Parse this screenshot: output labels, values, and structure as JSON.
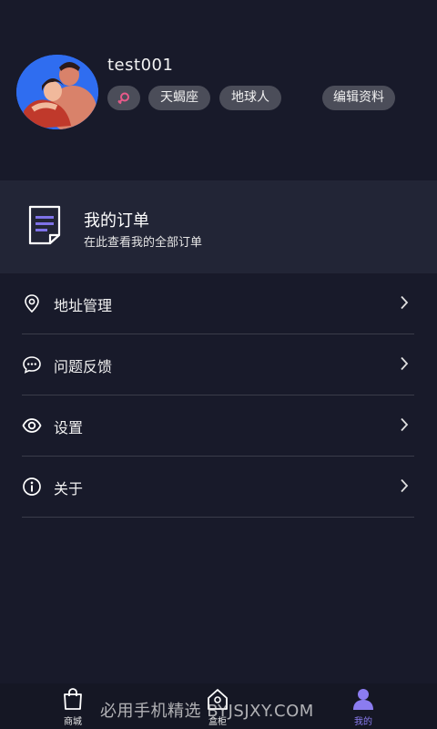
{
  "profile": {
    "username": "test001",
    "tags": {
      "gender_icon": "female-symbol-icon",
      "zodiac": "天蝎座",
      "planet": "地球人"
    },
    "edit_label": "编辑资料"
  },
  "orders": {
    "title": "我的订单",
    "subtitle": "在此查看我的全部订单",
    "icon": "document-icon"
  },
  "menu": {
    "items": [
      {
        "label": "地址管理",
        "icon": "location-pin-icon"
      },
      {
        "label": "问题反馈",
        "icon": "chat-bubble-icon"
      },
      {
        "label": "设置",
        "icon": "eye-icon"
      },
      {
        "label": "关于",
        "icon": "info-icon"
      }
    ]
  },
  "nav": {
    "items": [
      {
        "label": "商城",
        "icon": "shopping-bag-icon"
      },
      {
        "label": "盒柜",
        "icon": "house-icon"
      },
      {
        "label": "我的",
        "icon": "person-icon"
      }
    ],
    "active_index": 2
  },
  "watermark": "必用手机精选 BYJSJXY.COM",
  "colors": {
    "background": "#181a2a",
    "card": "#222536",
    "tag": "#4b4d59",
    "accent": "#8b7cf0",
    "gender_pink": "#e85a8a"
  }
}
